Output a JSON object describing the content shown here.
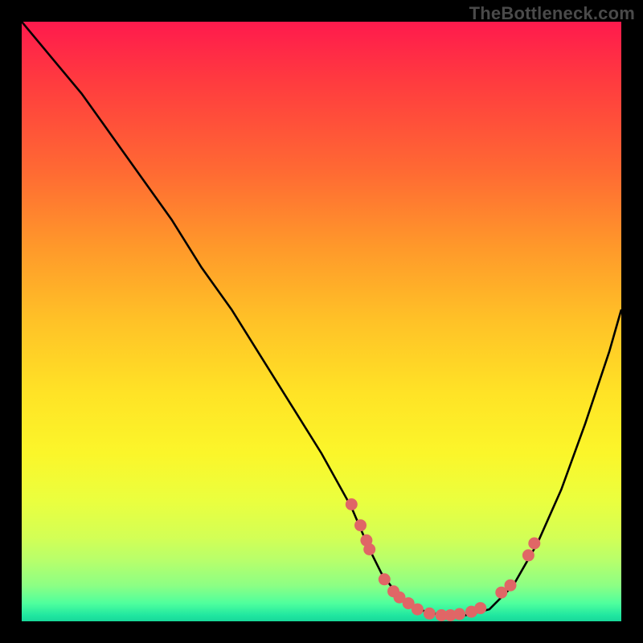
{
  "watermark": "TheBottleneck.com",
  "chart_data": {
    "type": "line",
    "title": "",
    "xlabel": "",
    "ylabel": "",
    "xlim": [
      0,
      100
    ],
    "ylim": [
      0,
      100
    ],
    "grid": false,
    "series": [
      {
        "name": "curve",
        "x": [
          0,
          5,
          10,
          15,
          20,
          25,
          30,
          35,
          40,
          45,
          50,
          55,
          58,
          60,
          63,
          66,
          70,
          74,
          78,
          82,
          86,
          90,
          94,
          98,
          100
        ],
        "y": [
          100,
          94,
          88,
          81,
          74,
          67,
          59,
          52,
          44,
          36,
          28,
          19,
          12,
          8,
          4,
          2,
          1,
          1,
          2,
          6,
          13,
          22,
          33,
          45,
          52
        ]
      },
      {
        "name": "markers",
        "x": [
          55.0,
          56.5,
          57.5,
          58.0,
          60.5,
          62.0,
          63.0,
          64.5,
          66.0,
          68.0,
          70.0,
          71.5,
          73.0,
          75.0,
          76.5,
          80.0,
          81.5,
          84.5,
          85.5
        ],
        "y": [
          19.5,
          16.0,
          13.5,
          12.0,
          7.0,
          5.0,
          4.0,
          3.0,
          2.0,
          1.3,
          1.0,
          1.0,
          1.2,
          1.6,
          2.2,
          4.8,
          6.0,
          11.0,
          13.0
        ]
      }
    ],
    "colors": {
      "curve": "#000000",
      "markers": "#e06666",
      "background_top": "#ff1a4d",
      "background_bottom": "#18d89a"
    }
  }
}
